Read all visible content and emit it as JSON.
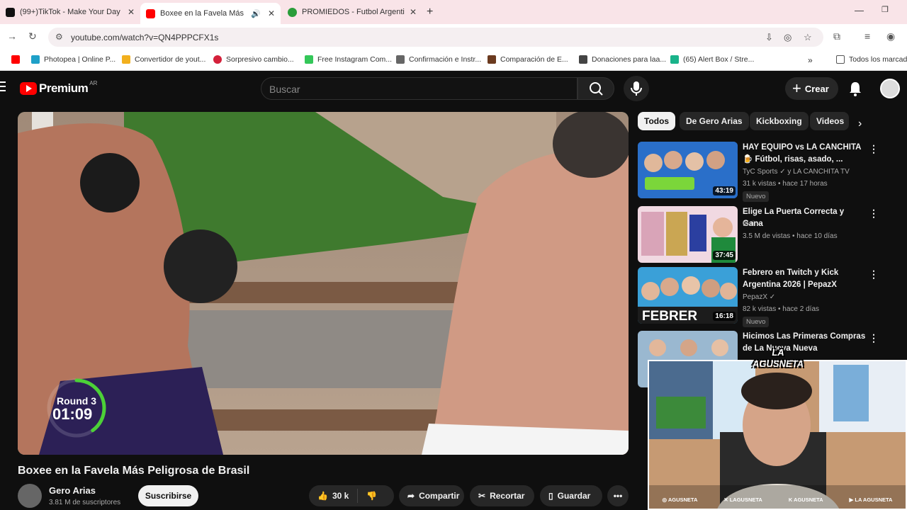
{
  "browser": {
    "tabs": [
      {
        "title": "(99+)TikTok - Make Your Day",
        "color": "#111111"
      },
      {
        "title": "Boxee en la Favela Más Peligrosa de Brasil",
        "color": "#ff0000",
        "active": true
      },
      {
        "title": "PROMIEDOS - Futbol Argentino",
        "color": "#2a9d3a"
      }
    ],
    "url": "youtube.com/watch?v=QN4PPPCFX1s",
    "bookmarks": [
      {
        "label": "",
        "color": "#ff0000"
      },
      {
        "label": "Photopea | Online P...",
        "color": "#1fa0c8"
      },
      {
        "label": "Convertidor de yout...",
        "color": "#f2b01e"
      },
      {
        "label": "Sorpresivo cambio...",
        "color": "#d4203a"
      },
      {
        "label": "Free Instagram Com...",
        "color": "#34c759"
      },
      {
        "label": "Confirmación e Instr...",
        "color": "#666666"
      },
      {
        "label": "Comparación de E...",
        "color": "#6b3a1f"
      },
      {
        "label": "Donaciones para laa...",
        "color": "#444444"
      },
      {
        "label": "(65) Alert Box / Stre...",
        "color": "#19b38a"
      },
      {
        "label": "Todos los marcadores",
        "color": "#555555"
      }
    ]
  },
  "header": {
    "logo_text": "Premium",
    "logo_region": "AR",
    "search_placeholder": "Buscar",
    "create_label": "Crear"
  },
  "video": {
    "title": "Boxee en la Favela Más Peligrosa de Brasil",
    "overlay_round": "Round 3",
    "overlay_time": "01:09",
    "round_progress": 0.4,
    "channel": "Gero Arias",
    "subscribers": "3.81 M de suscriptores",
    "subscribe_label": "Suscribirse",
    "likes": "30 k",
    "share_label": "Compartir",
    "clip_label": "Recortar",
    "save_label": "Guardar"
  },
  "chips": [
    "Todos",
    "De Gero Arias",
    "Kickboxing",
    "Videos"
  ],
  "recommendations": [
    {
      "title": "HAY EQUIPO vs LA CANCHITA 🍺 Fútbol, risas, asado, ...",
      "channel": "TyC Sports ✓ y LA CANCHITA TV",
      "meta": "31 k vistas • hace 17 horas",
      "badge": "Nuevo",
      "duration": "43:19",
      "thumb_color": "#2a6fc9"
    },
    {
      "title": "Elige La Puerta Correcta y Gana",
      "channel": "Ibai ✓",
      "meta": "3.5 M de vistas • hace 10 días",
      "badge": "",
      "duration": "37:45",
      "thumb_color": "#d9a4b8"
    },
    {
      "title": "Febrero en Twitch y Kick Argentina 2026 | PepazX",
      "channel": "PepazX ✓",
      "meta": "82 k vistas • hace 2 días",
      "badge": "Nuevo",
      "duration": "16:18",
      "thumb_color": "#3aa0d8"
    },
    {
      "title": "Hicimos Las Primeras Compras de La Nueva Nueva",
      "channel": "",
      "meta": "",
      "badge": "",
      "duration": "",
      "thumb_color": "#9ab8d0"
    }
  ],
  "webcam": {
    "logo_text": "LA AGUSNETA",
    "handles": [
      "AGUSNETA",
      "LAGUSNETA",
      "AGUSNETA",
      "LA AGUSNETA"
    ]
  }
}
